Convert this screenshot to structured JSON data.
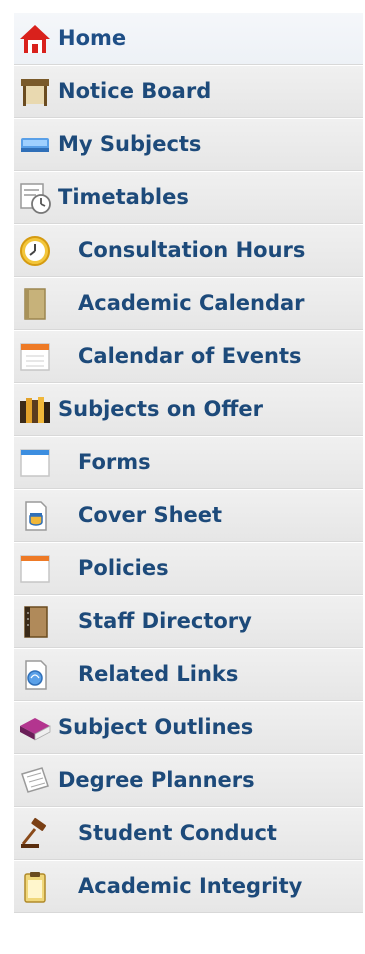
{
  "nav": {
    "items": [
      {
        "label": "Home",
        "icon": "home-icon"
      },
      {
        "label": "Notice Board",
        "icon": "notice-board-icon"
      },
      {
        "label": "My Subjects",
        "icon": "subjects-icon"
      },
      {
        "label": "Timetables",
        "icon": "timetable-icon"
      },
      {
        "label": "Consultation Hours",
        "icon": "clock-icon"
      },
      {
        "label": "Academic Calendar",
        "icon": "book-icon"
      },
      {
        "label": "Calendar of Events",
        "icon": "calendar-icon"
      },
      {
        "label": "Subjects on Offer",
        "icon": "books-icon"
      },
      {
        "label": "Forms",
        "icon": "form-window-icon"
      },
      {
        "label": "Cover Sheet",
        "icon": "cover-sheet-icon"
      },
      {
        "label": "Policies",
        "icon": "policies-window-icon"
      },
      {
        "label": "Staff Directory",
        "icon": "directory-icon"
      },
      {
        "label": "Related Links",
        "icon": "links-icon"
      },
      {
        "label": "Subject Outlines",
        "icon": "outline-book-icon"
      },
      {
        "label": "Degree Planners",
        "icon": "planner-icon"
      },
      {
        "label": "Student Conduct",
        "icon": "gavel-icon"
      },
      {
        "label": "Academic Integrity",
        "icon": "clipboard-icon"
      }
    ]
  }
}
